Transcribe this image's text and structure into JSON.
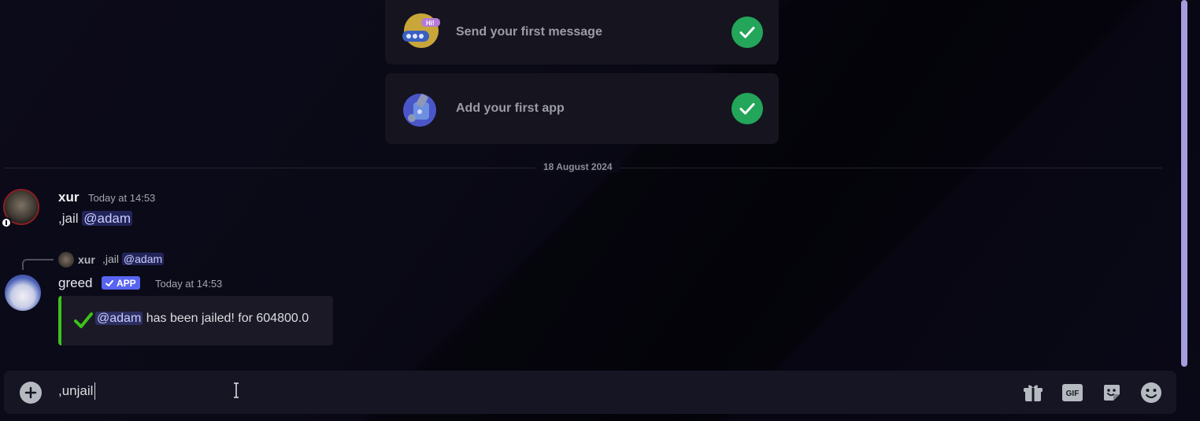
{
  "checklist": {
    "items": [
      {
        "label": "Send your first message",
        "icon": "hi-bubble-icon",
        "done": true
      },
      {
        "label": "Add your first app",
        "icon": "wrench-robot-icon",
        "done": true
      }
    ]
  },
  "divider": {
    "date": "18 August 2024"
  },
  "messages": [
    {
      "author": "xur",
      "timestamp": "Today at 14:53",
      "text_prefix": ",jail",
      "mention": "@adam"
    },
    {
      "reply": {
        "author": "xur",
        "text_prefix": ",jail",
        "mention": "@adam"
      },
      "author": "greed",
      "badge": "APP",
      "timestamp": "Today at 14:53",
      "embed": {
        "mention": "@adam",
        "text": "has been jailed! for 604800.0",
        "accent": "#3cc11b"
      }
    }
  ],
  "composer": {
    "value": ",unjail",
    "icons": [
      "gift-icon",
      "gif-icon",
      "sticker-icon",
      "emoji-icon"
    ],
    "gif_label": "GIF"
  },
  "colors": {
    "accent": "#5865f2",
    "success": "#23a55a",
    "scrollbar": "#a49ee0"
  }
}
